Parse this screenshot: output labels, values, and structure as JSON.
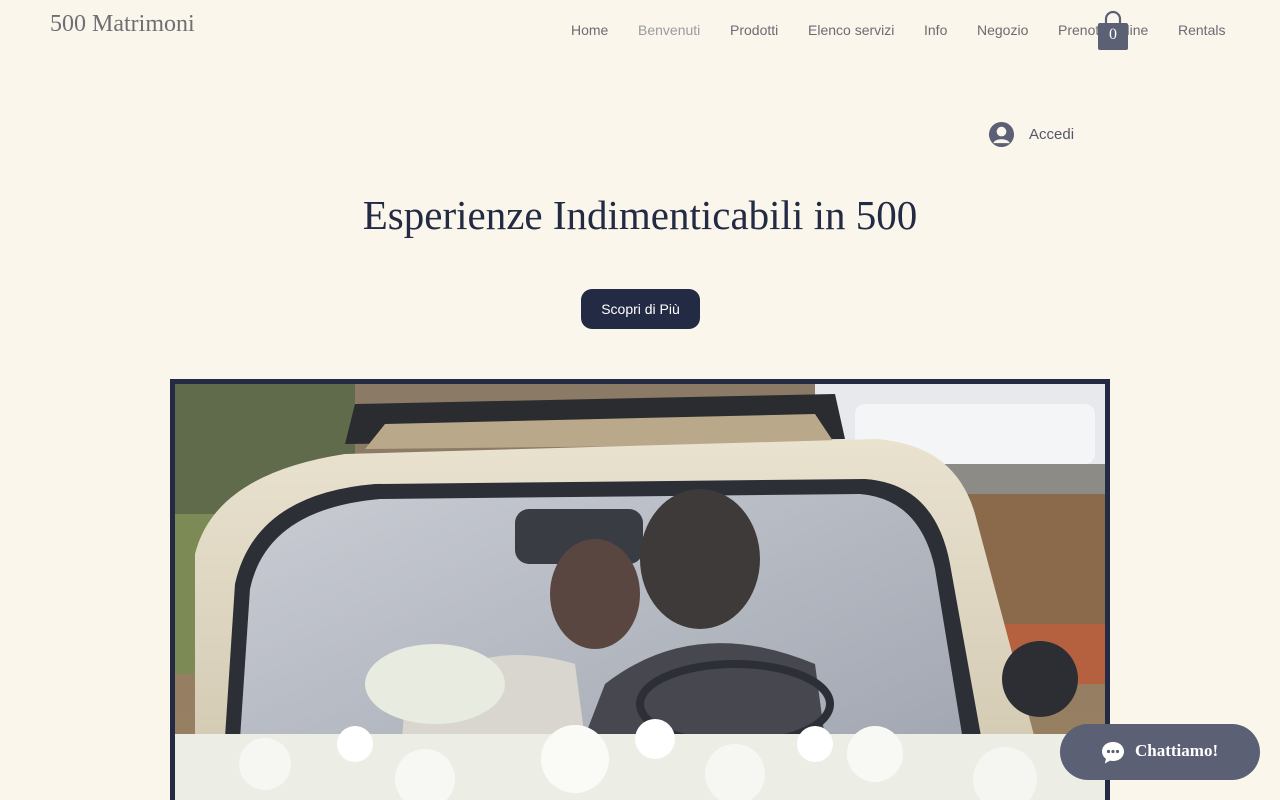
{
  "site": {
    "logo": "500 Matrimoni"
  },
  "nav": {
    "items": [
      {
        "label": "Home"
      },
      {
        "label": "Benvenuti",
        "active": true
      },
      {
        "label": "Prodotti"
      },
      {
        "label": "Elenco servizi"
      },
      {
        "label": "Info"
      },
      {
        "label": "Negozio"
      },
      {
        "label": "Prenota online"
      },
      {
        "label": "Rentals"
      }
    ]
  },
  "cart": {
    "count": "0",
    "icon": "shopping-bag-icon"
  },
  "login": {
    "label": "Accedi",
    "icon": "user-avatar-icon"
  },
  "hero": {
    "title": "Esperienze Indimenticabili in 500",
    "cta_label": "Scopri di Più"
  },
  "chat": {
    "label": "Chattiamo!",
    "icon": "chat-bubble-icon"
  },
  "colors": {
    "background": "#fbf6ec",
    "primary": "#232a44",
    "nav_text": "#6b6b72",
    "chat_bg": "#5b6075"
  }
}
